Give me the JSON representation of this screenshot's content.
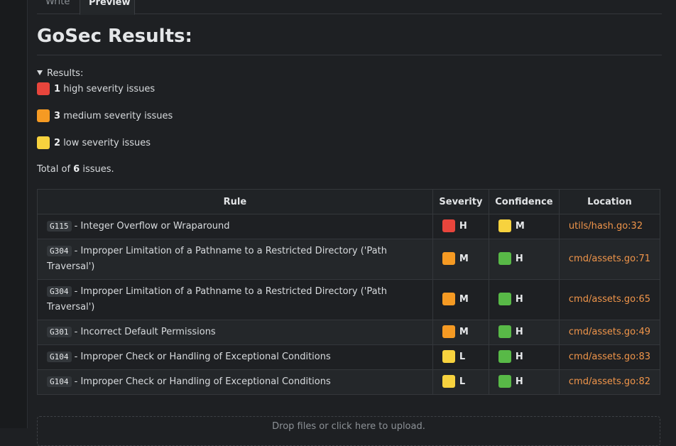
{
  "tabs": {
    "write": "Write",
    "preview": "Preview"
  },
  "heading": "GoSec Results:",
  "summary": {
    "label": "Results:",
    "high": {
      "count": "1",
      "text": "high severity issues"
    },
    "medium": {
      "count": "3",
      "text": "medium severity issues"
    },
    "low": {
      "count": "2",
      "text": "low severity issues"
    },
    "total_prefix": "Total of",
    "total_count": "6",
    "total_suffix": "issues."
  },
  "table": {
    "headers": [
      "Rule",
      "Severity",
      "Confidence",
      "Location"
    ],
    "rows": [
      {
        "code": "G115",
        "rule": "- Integer Overflow or Wraparound",
        "severity": "H",
        "severity_color": "red",
        "confidence": "M",
        "confidence_color": "yellow",
        "location": "utils/hash.go:32"
      },
      {
        "code": "G304",
        "rule": "- Improper Limitation of a Pathname to a Restricted Directory ('Path Traversal')",
        "severity": "M",
        "severity_color": "orange",
        "confidence": "H",
        "confidence_color": "green",
        "location": "cmd/assets.go:71"
      },
      {
        "code": "G304",
        "rule": "- Improper Limitation of a Pathname to a Restricted Directory ('Path Traversal')",
        "severity": "M",
        "severity_color": "orange",
        "confidence": "H",
        "confidence_color": "green",
        "location": "cmd/assets.go:65"
      },
      {
        "code": "G301",
        "rule": "- Incorrect Default Permissions",
        "severity": "M",
        "severity_color": "orange",
        "confidence": "H",
        "confidence_color": "green",
        "location": "cmd/assets.go:49"
      },
      {
        "code": "G104",
        "rule": "- Improper Check or Handling of Exceptional Conditions",
        "severity": "L",
        "severity_color": "yellow",
        "confidence": "H",
        "confidence_color": "green",
        "location": "cmd/assets.go:83"
      },
      {
        "code": "G104",
        "rule": "- Improper Check or Handling of Exceptional Conditions",
        "severity": "L",
        "severity_color": "yellow",
        "confidence": "H",
        "confidence_color": "green",
        "location": "cmd/assets.go:82"
      }
    ]
  },
  "dropzone": "Drop files or click here to upload.",
  "colors": {
    "background": "#1e2023",
    "link": "#f0954a",
    "red": "#e8453c",
    "orange": "#f59a23",
    "yellow": "#f7d23e",
    "green": "#58b947"
  }
}
